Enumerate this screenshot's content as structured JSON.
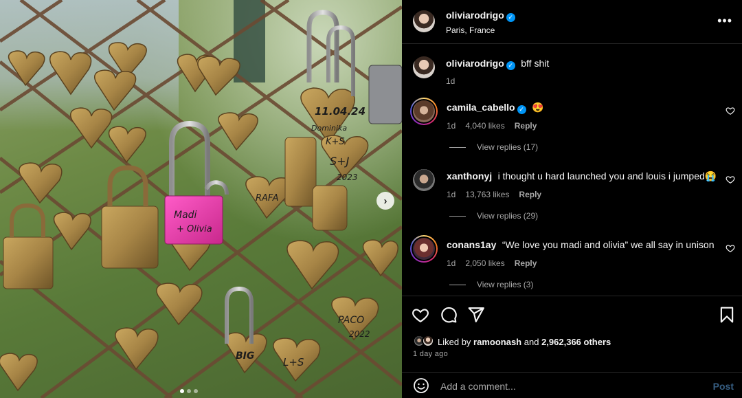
{
  "post": {
    "author": "oliviarodrigo",
    "location": "Paris, France",
    "verified": true
  },
  "caption": {
    "username": "oliviarodrigo",
    "text": "bff shit",
    "time": "1d"
  },
  "comments": [
    {
      "username": "camila_cabello",
      "verified": true,
      "text": "😍",
      "time": "1d",
      "likes": "4,040 likes",
      "reply": "Reply",
      "view_replies": "View replies (17)",
      "has_story_ring": true
    },
    {
      "username": "xanthonyj",
      "verified": false,
      "text": "i thought u hard launched you and louis i jumped😭",
      "time": "1d",
      "likes": "13,763 likes",
      "reply": "Reply",
      "view_replies": "View replies (29)",
      "has_story_ring": false
    },
    {
      "username": "conans1ay",
      "verified": false,
      "text": "“We love you madi and olivia” we all say in unison",
      "time": "1d",
      "likes": "2,050 likes",
      "reply": "Reply",
      "view_replies": "View replies (3)",
      "has_story_ring": true
    }
  ],
  "likes": {
    "prefix": "Liked by",
    "user": "ramoonash",
    "and": "and",
    "others": "2,962,366 others"
  },
  "posted": "1 day ago",
  "composer": {
    "placeholder": "Add a comment...",
    "post_label": "Post"
  },
  "carousel": {
    "slide_count": 3,
    "active_index": 0
  },
  "photo": {
    "pink_lock_text_1": "Madi",
    "pink_lock_text_2": "+ Olivia",
    "lock_texts": [
      "11.04.24",
      "Dominika",
      "K+S",
      "S+J",
      "2023",
      "RAFA",
      "PACO",
      "2022",
      "BIG",
      "L+S"
    ]
  },
  "icons": {
    "more": "more-horizontal-icon",
    "like": "heart-icon",
    "comment": "comment-icon",
    "share": "send-icon",
    "save": "bookmark-icon",
    "emoji": "emoji-icon",
    "verified": "verified-badge-icon",
    "next": "chevron-right-icon"
  },
  "colors": {
    "background": "#000000",
    "text": "#f5f5f5",
    "muted": "#a8a8a8",
    "verified": "#0095f6",
    "divider": "#262626",
    "post_disabled": "#365e82",
    "pink_lock": "#e83fa6"
  }
}
